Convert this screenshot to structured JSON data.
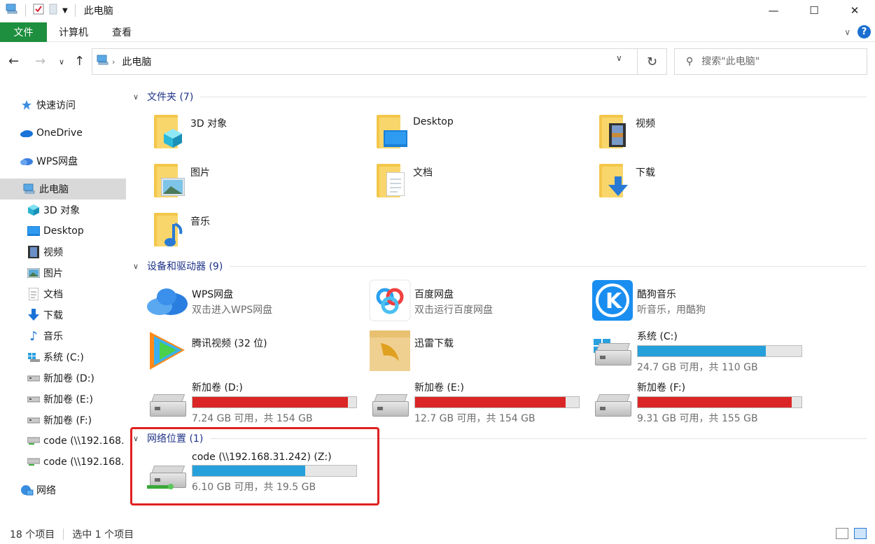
{
  "title": "此电脑",
  "ribbon": {
    "file": "文件",
    "computer": "计算机",
    "view": "查看"
  },
  "address": {
    "crumb": "此电脑"
  },
  "search": {
    "placeholder": "搜索\"此电脑\""
  },
  "sidebar": {
    "items": [
      {
        "label": "快速访问",
        "icon": "star-icon"
      },
      {
        "label": "OneDrive",
        "icon": "cloud-icon"
      },
      {
        "label": "WPS网盘",
        "icon": "wps-cloud-icon"
      },
      {
        "label": "此电脑",
        "icon": "computer-icon"
      },
      {
        "label": "3D 对象",
        "icon": "cube-icon"
      },
      {
        "label": "Desktop",
        "icon": "desktop-icon"
      },
      {
        "label": "视频",
        "icon": "film-icon"
      },
      {
        "label": "图片",
        "icon": "picture-icon"
      },
      {
        "label": "文档",
        "icon": "document-icon"
      },
      {
        "label": "下载",
        "icon": "download-icon"
      },
      {
        "label": "音乐",
        "icon": "music-icon"
      },
      {
        "label": "系统 (C:)",
        "icon": "system-drive-icon"
      },
      {
        "label": "新加卷 (D:)",
        "icon": "drive-icon"
      },
      {
        "label": "新加卷 (E:)",
        "icon": "drive-icon"
      },
      {
        "label": "新加卷 (F:)",
        "icon": "drive-icon"
      },
      {
        "label": "code (\\\\192.168.",
        "icon": "network-drive-icon"
      },
      {
        "label": "code (\\\\192.168.",
        "icon": "network-drive-icon"
      },
      {
        "label": "网络",
        "icon": "network-icon"
      }
    ]
  },
  "groups": {
    "folders": {
      "title": "文件夹 (7)"
    },
    "devices": {
      "title": "设备和驱动器 (9)"
    },
    "network": {
      "title": "网络位置 (1)"
    }
  },
  "folders": [
    {
      "name": "3D 对象",
      "icon": "cube-icon"
    },
    {
      "name": "Desktop",
      "icon": "desktop-icon"
    },
    {
      "name": "视频",
      "icon": "film-icon"
    },
    {
      "name": "图片",
      "icon": "picture-icon"
    },
    {
      "name": "文档",
      "icon": "document-icon"
    },
    {
      "name": "下载",
      "icon": "download-icon"
    },
    {
      "name": "音乐",
      "icon": "music-icon"
    }
  ],
  "apps": [
    {
      "name": "WPS网盘",
      "sub": "双击进入WPS网盘",
      "icon": "wps-cloud-icon"
    },
    {
      "name": "百度网盘",
      "sub": "双击运行百度网盘",
      "icon": "baidu-netdisk-icon"
    },
    {
      "name": "酷狗音乐",
      "sub": "听音乐，用酷狗",
      "icon": "kugou-icon"
    },
    {
      "name": "腾讯视频 (32 位)",
      "sub": "",
      "icon": "tencent-video-icon"
    },
    {
      "name": "迅雷下载",
      "sub": "",
      "icon": "xunlei-icon"
    }
  ],
  "drives": [
    {
      "name": "系统 (C:)",
      "free": "24.7 GB 可用，共 110 GB",
      "used_fraction": 0.78,
      "color": "#26a0da"
    },
    {
      "name": "新加卷 (D:)",
      "free": "7.24 GB 可用，共 154 GB",
      "used_fraction": 0.95,
      "color": "#da2626"
    },
    {
      "name": "新加卷 (E:)",
      "free": "12.7 GB 可用，共 154 GB",
      "used_fraction": 0.92,
      "color": "#da2626"
    },
    {
      "name": "新加卷 (F:)",
      "free": "9.31 GB 可用，共 155 GB",
      "used_fraction": 0.94,
      "color": "#da2626"
    }
  ],
  "network_drive": {
    "name": "code (\\\\192.168.31.242) (Z:)",
    "free": "6.10 GB 可用，共 19.5 GB",
    "used_fraction": 0.69,
    "color": "#26a0da"
  },
  "status": {
    "items": "18 个项目",
    "selected": "选中 1 个项目"
  }
}
